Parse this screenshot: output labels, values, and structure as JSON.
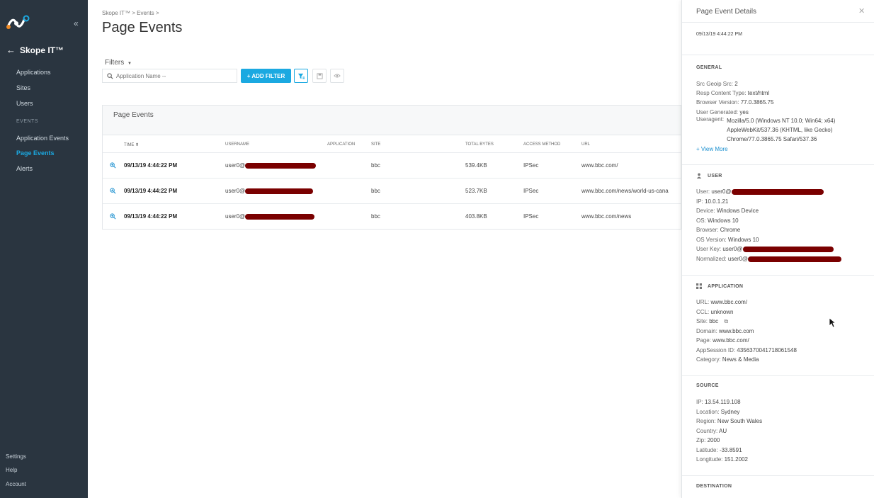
{
  "sidebar": {
    "product": "Skope IT™",
    "items": [
      {
        "label": "Applications"
      },
      {
        "label": "Sites"
      },
      {
        "label": "Users"
      }
    ],
    "section": "EVENTS",
    "events": [
      {
        "label": "Application Events"
      },
      {
        "label": "Page Events"
      },
      {
        "label": "Alerts"
      }
    ],
    "bottom": [
      {
        "label": "Settings"
      },
      {
        "label": "Help"
      },
      {
        "label": "Account"
      }
    ]
  },
  "main": {
    "breadcrumb": "Skope IT™ > Events >",
    "title": "Page Events",
    "filters_label": "Filters",
    "search_placeholder": "Application Name --",
    "add_filter": "+ ADD FILTER",
    "panel_title": "Page Events",
    "columns": [
      "TIME",
      "USERNAME",
      "APPLICATION",
      "SITE",
      "TOTAL BYTES",
      "ACCESS METHOD",
      "URL"
    ],
    "rows": [
      {
        "time": "09/13/19 4:44:22 PM",
        "username": "user0@",
        "application": "",
        "site": "bbc",
        "bytes": "539.4KB",
        "method": "IPSec",
        "url": "www.bbc.com/"
      },
      {
        "time": "09/13/19 4:44:22 PM",
        "username": "user0@",
        "application": "",
        "site": "bbc",
        "bytes": "523.7KB",
        "method": "IPSec",
        "url": "www.bbc.com/news/world-us-cana"
      },
      {
        "time": "09/13/19 4:44:22 PM",
        "username": "user0@",
        "application": "",
        "site": "bbc",
        "bytes": "403.8KB",
        "method": "IPSec",
        "url": "www.bbc.com/news"
      }
    ]
  },
  "drawer": {
    "title": "Page Event Details",
    "timestamp": "09/13/19 4:44:22 PM",
    "general": {
      "title": "GENERAL",
      "fields": [
        {
          "k": "Src Geoip Src:",
          "v": "2"
        },
        {
          "k": "Resp Content Type:",
          "v": "text/html"
        },
        {
          "k": "Browser Version:",
          "v": "77.0.3865.75"
        },
        {
          "k": "User Generated:",
          "v": "yes"
        }
      ],
      "useragent_key": "Useragent:",
      "useragent_val": "Mozilla/5.0 (Windows NT 10.0; Win64; x64) AppleWebKit/537.36 (KHTML, like Gecko) Chrome/77.0.3865.75 Safari/537.36",
      "view_more": "+ View More"
    },
    "user": {
      "title": "USER",
      "fields": [
        {
          "k": "User:",
          "v": "user0@"
        },
        {
          "k": "IP:",
          "v": "10.0.1.21"
        },
        {
          "k": "Device:",
          "v": "Windows Device"
        },
        {
          "k": "OS:",
          "v": "Windows 10"
        },
        {
          "k": "Browser:",
          "v": "Chrome"
        },
        {
          "k": "OS Version:",
          "v": "Windows 10"
        },
        {
          "k": "User Key:",
          "v": "user0@"
        },
        {
          "k": "Normalized:",
          "v": "user0@"
        }
      ]
    },
    "application": {
      "title": "APPLICATION",
      "fields": [
        {
          "k": "URL:",
          "v": "www.bbc.com/"
        },
        {
          "k": "CCL:",
          "v": "unknown"
        },
        {
          "k": "Site:",
          "v": "bbc"
        },
        {
          "k": "Domain:",
          "v": "www.bbc.com"
        },
        {
          "k": "Page:",
          "v": "www.bbc.com/"
        },
        {
          "k": "AppSession ID:",
          "v": "4356370041718061548"
        },
        {
          "k": "Category:",
          "v": "News & Media"
        }
      ]
    },
    "source": {
      "title": "SOURCE",
      "fields": [
        {
          "k": "IP:",
          "v": "13.54.119.108"
        },
        {
          "k": "Location:",
          "v": "Sydney"
        },
        {
          "k": "Region:",
          "v": "New South Wales"
        },
        {
          "k": "Country:",
          "v": "AU"
        },
        {
          "k": "Zip:",
          "v": "2000"
        },
        {
          "k": "Latitude:",
          "v": "-33.8591"
        },
        {
          "k": "Longitude:",
          "v": "151.2002"
        }
      ]
    },
    "destination": {
      "title": "DESTINATION"
    }
  }
}
